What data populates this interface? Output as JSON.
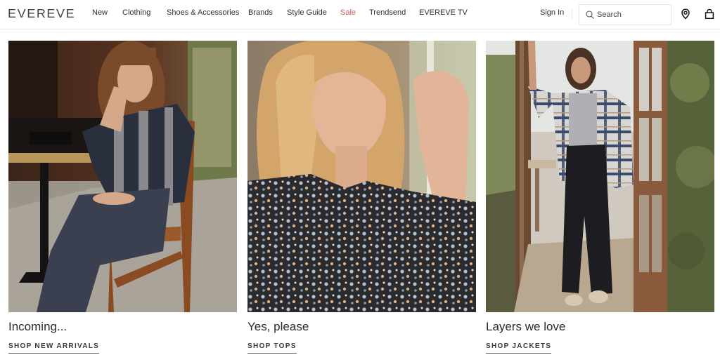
{
  "header": {
    "logo": "EVEREVE",
    "nav": [
      {
        "label": "New"
      },
      {
        "label": "Clothing"
      },
      {
        "label": "Shoes & Accessories"
      },
      {
        "label": "Brands"
      },
      {
        "label": "Style Guide"
      },
      {
        "label": "Sale"
      },
      {
        "label": "Trendsend"
      },
      {
        "label": "EVEREVE TV"
      }
    ],
    "sign_in": "Sign In",
    "search": {
      "placeholder": "Search",
      "value": ""
    },
    "icons": {
      "search": "search-icon",
      "location": "location-pin-icon",
      "bag": "shopping-bag-icon"
    },
    "sale_color": "#d8585f"
  },
  "cards": [
    {
      "title": "Incoming...",
      "link": "SHOP NEW ARRIVALS",
      "image_alt": "Woman in striped shirt and jeans seated at cafe table"
    },
    {
      "title": "Yes, please",
      "link": "SHOP TOPS",
      "image_alt": "Blonde woman in floral print blouse"
    },
    {
      "title": "Layers we love",
      "link": "SHOP JACKETS",
      "image_alt": "Woman in plaid shacket and wide-leg pants in greenhouse doorway"
    }
  ]
}
